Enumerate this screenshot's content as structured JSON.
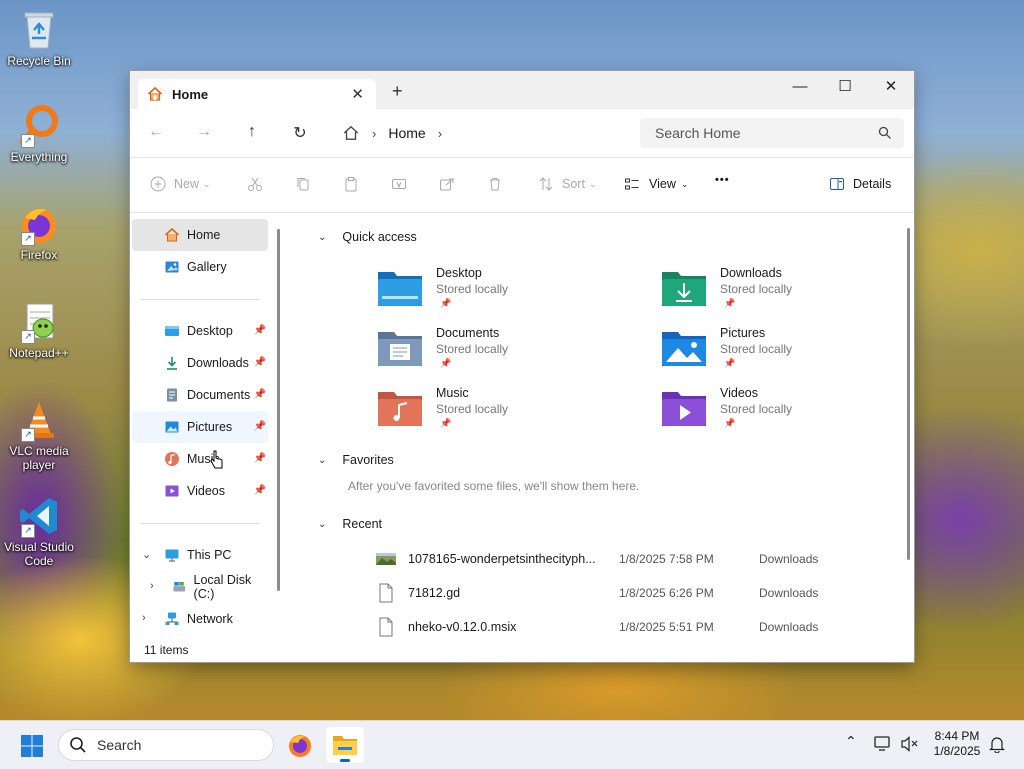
{
  "desktop": {
    "icons": [
      {
        "label": "Recycle Bin"
      },
      {
        "label": "Everything"
      },
      {
        "label": "Firefox"
      },
      {
        "label": "Notepad++"
      },
      {
        "label": "VLC media player"
      },
      {
        "label": "Visual Studio Code"
      }
    ]
  },
  "window": {
    "tab_title": "Home",
    "new_tab_glyph": "+",
    "controls": {
      "minimize": "—",
      "maximize": "☐",
      "close": "✕"
    },
    "address": {
      "breadcrumb": [
        "Home"
      ],
      "search_placeholder": "Search Home"
    },
    "toolbar": {
      "new_label": "New",
      "sort_label": "Sort",
      "view_label": "View",
      "more_label": "•••",
      "details_label": "Details"
    },
    "sidebar": {
      "top": [
        {
          "label": "Home",
          "icon": "home-icon",
          "selected": true
        },
        {
          "label": "Gallery",
          "icon": "gallery-icon"
        }
      ],
      "pinned": [
        {
          "label": "Desktop",
          "icon": "desktop-folder-icon"
        },
        {
          "label": "Downloads",
          "icon": "downloads-folder-icon"
        },
        {
          "label": "Documents",
          "icon": "documents-folder-icon"
        },
        {
          "label": "Pictures",
          "icon": "pictures-folder-icon"
        },
        {
          "label": "Music",
          "icon": "music-folder-icon"
        },
        {
          "label": "Videos",
          "icon": "videos-folder-icon"
        }
      ],
      "this_pc": "This PC",
      "local_disk": "Local Disk (C:)",
      "network": "Network"
    },
    "content": {
      "quick_access": {
        "heading": "Quick access",
        "items": [
          {
            "name": "Desktop",
            "sub": "Stored locally",
            "color": "#1e8fd6"
          },
          {
            "name": "Downloads",
            "sub": "Stored locally",
            "color": "#1fa67a"
          },
          {
            "name": "Documents",
            "sub": "Stored locally",
            "color": "#6f8fb8"
          },
          {
            "name": "Pictures",
            "sub": "Stored locally",
            "color": "#1e88e5"
          },
          {
            "name": "Music",
            "sub": "Stored locally",
            "color": "#e2745a"
          },
          {
            "name": "Videos",
            "sub": "Stored locally",
            "color": "#8b4fd8"
          }
        ]
      },
      "favorites": {
        "heading": "Favorites",
        "empty_text": "After you've favorited some files, we'll show them here."
      },
      "recent": {
        "heading": "Recent",
        "rows": [
          {
            "name": "1078165-wonderpetsinthecityph...",
            "date": "1/8/2025 7:58 PM",
            "location": "Downloads"
          },
          {
            "name": "71812.gd",
            "date": "1/8/2025 6:26 PM",
            "location": "Downloads"
          },
          {
            "name": "nheko-v0.12.0.msix",
            "date": "1/8/2025 5:51 PM",
            "location": "Downloads"
          }
        ]
      }
    },
    "status": {
      "items_count": "11 items"
    }
  },
  "taskbar": {
    "search_label": "Search",
    "clock_time": "8:44 PM",
    "clock_date": "1/8/2025"
  }
}
